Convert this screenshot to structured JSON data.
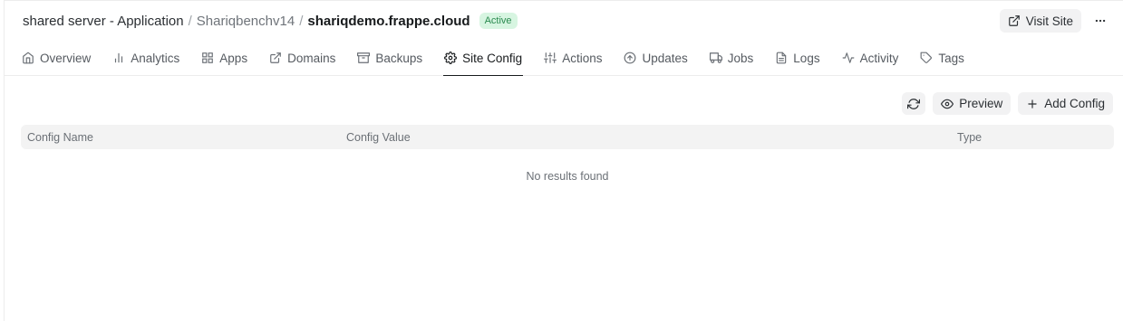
{
  "breadcrumb": {
    "root": "shared server - Application",
    "bench": "Shariqbenchv14",
    "site": "shariqdemo.frappe.cloud",
    "separator": "/"
  },
  "status_badge": "Active",
  "header": {
    "visit_site_label": "Visit Site",
    "more_label": "..."
  },
  "tabs": [
    {
      "label": "Overview",
      "icon": "home-icon"
    },
    {
      "label": "Analytics",
      "icon": "bar-chart-icon"
    },
    {
      "label": "Apps",
      "icon": "grid-icon"
    },
    {
      "label": "Domains",
      "icon": "external-link-icon"
    },
    {
      "label": "Backups",
      "icon": "archive-icon"
    },
    {
      "label": "Site Config",
      "icon": "gear-icon",
      "active": true
    },
    {
      "label": "Actions",
      "icon": "sliders-icon"
    },
    {
      "label": "Updates",
      "icon": "arrow-up-circle-icon"
    },
    {
      "label": "Jobs",
      "icon": "truck-icon"
    },
    {
      "label": "Logs",
      "icon": "file-text-icon"
    },
    {
      "label": "Activity",
      "icon": "activity-icon"
    },
    {
      "label": "Tags",
      "icon": "tag-icon"
    }
  ],
  "toolbar": {
    "preview_label": "Preview",
    "add_config_label": "Add Config"
  },
  "table": {
    "columns": [
      "Config Name",
      "Config Value",
      "Type"
    ],
    "empty_message": "No results found"
  },
  "colors": {
    "badge_bg": "#d7f5e1",
    "badge_text": "#2a8a4f",
    "button_bg": "#f2f2f3",
    "table_header_bg": "#f3f3f3"
  }
}
